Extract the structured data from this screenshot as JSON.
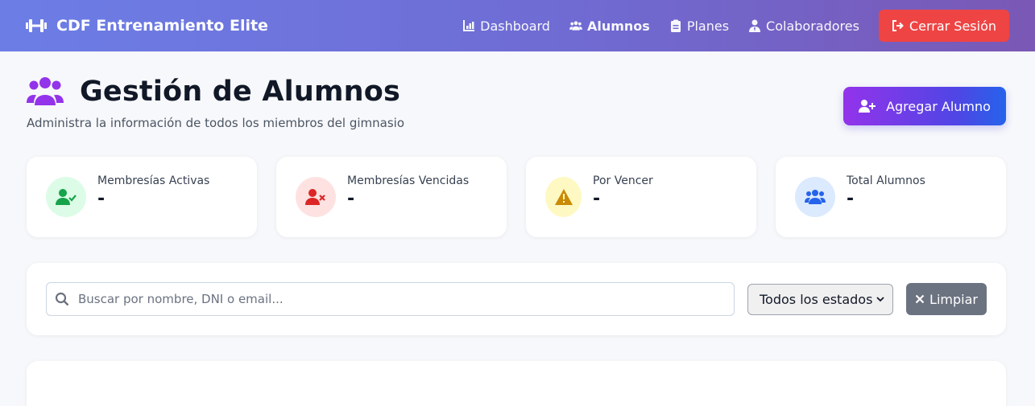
{
  "navbar": {
    "brand": "CDF Entrenamiento Elite",
    "links": [
      {
        "label": "Dashboard"
      },
      {
        "label": "Alumnos"
      },
      {
        "label": "Planes"
      },
      {
        "label": "Colaboradores"
      }
    ],
    "active": "Alumnos",
    "logout": "Cerrar Sesión"
  },
  "header": {
    "title": "Gestión de Alumnos",
    "subtitle": "Administra la información de todos los miembros del gimnasio",
    "add_button": "Agregar Alumno"
  },
  "stats": [
    {
      "label": "Membresías Activas",
      "value": "-",
      "icon": "user-check-icon",
      "bg": "#dcfce7",
      "color": "#16a34a"
    },
    {
      "label": "Membresías Vencidas",
      "value": "-",
      "icon": "user-x-icon",
      "bg": "#fee2e2",
      "color": "#dc2626"
    },
    {
      "label": "Por Vencer",
      "value": "-",
      "icon": "warning-icon",
      "bg": "#fef9c3",
      "color": "#ca8a04"
    },
    {
      "label": "Total Alumnos",
      "value": "-",
      "icon": "users-icon",
      "bg": "#dbeafe",
      "color": "#2563eb"
    }
  ],
  "filters": {
    "search_placeholder": "Buscar por nombre, DNI o email...",
    "search_value": "",
    "status_selected": "Todos los estados",
    "clear_button": "Limpiar"
  }
}
